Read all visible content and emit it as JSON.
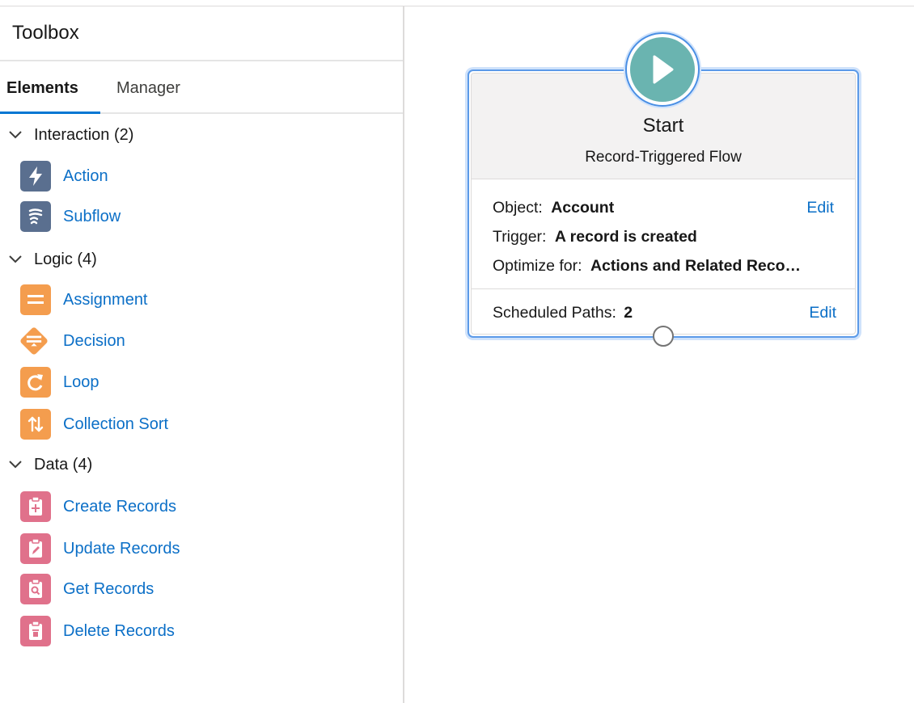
{
  "toolbox": {
    "title": "Toolbox",
    "tabs": {
      "elements": "Elements",
      "manager": "Manager"
    },
    "sections": {
      "interaction": {
        "label": "Interaction (2)",
        "items": [
          {
            "label": "Action",
            "icon": "lightning-icon"
          },
          {
            "label": "Subflow",
            "icon": "subflow-icon"
          }
        ]
      },
      "logic": {
        "label": "Logic (4)",
        "items": [
          {
            "label": "Assignment",
            "icon": "assignment-icon"
          },
          {
            "label": "Decision",
            "icon": "decision-icon"
          },
          {
            "label": "Loop",
            "icon": "loop-icon"
          },
          {
            "label": "Collection Sort",
            "icon": "sort-icon"
          }
        ]
      },
      "data": {
        "label": "Data (4)",
        "items": [
          {
            "label": "Create Records",
            "icon": "record-create-icon"
          },
          {
            "label": "Update Records",
            "icon": "record-update-icon"
          },
          {
            "label": "Get Records",
            "icon": "record-lookup-icon"
          },
          {
            "label": "Delete Records",
            "icon": "record-delete-icon"
          }
        ]
      }
    }
  },
  "start": {
    "title": "Start",
    "subtitle": "Record-Triggered Flow",
    "object_label": "Object:",
    "object_value": "Account",
    "trigger_label": "Trigger:",
    "trigger_value": "A record is created",
    "optimize_label": "Optimize for:",
    "optimize_value": "Actions and Related Reco…",
    "edit_label": "Edit",
    "scheduled_label": "Scheduled Paths:",
    "scheduled_value": "2",
    "scheduled_edit_label": "Edit"
  },
  "colors": {
    "interaction_icon": "#5a6f8f",
    "logic_icon": "#f49d4e",
    "data_icon": "#e0718b",
    "start_icon": "#6ab4b0",
    "link": "#0b6fc7",
    "selection": "#5b9ae8"
  }
}
